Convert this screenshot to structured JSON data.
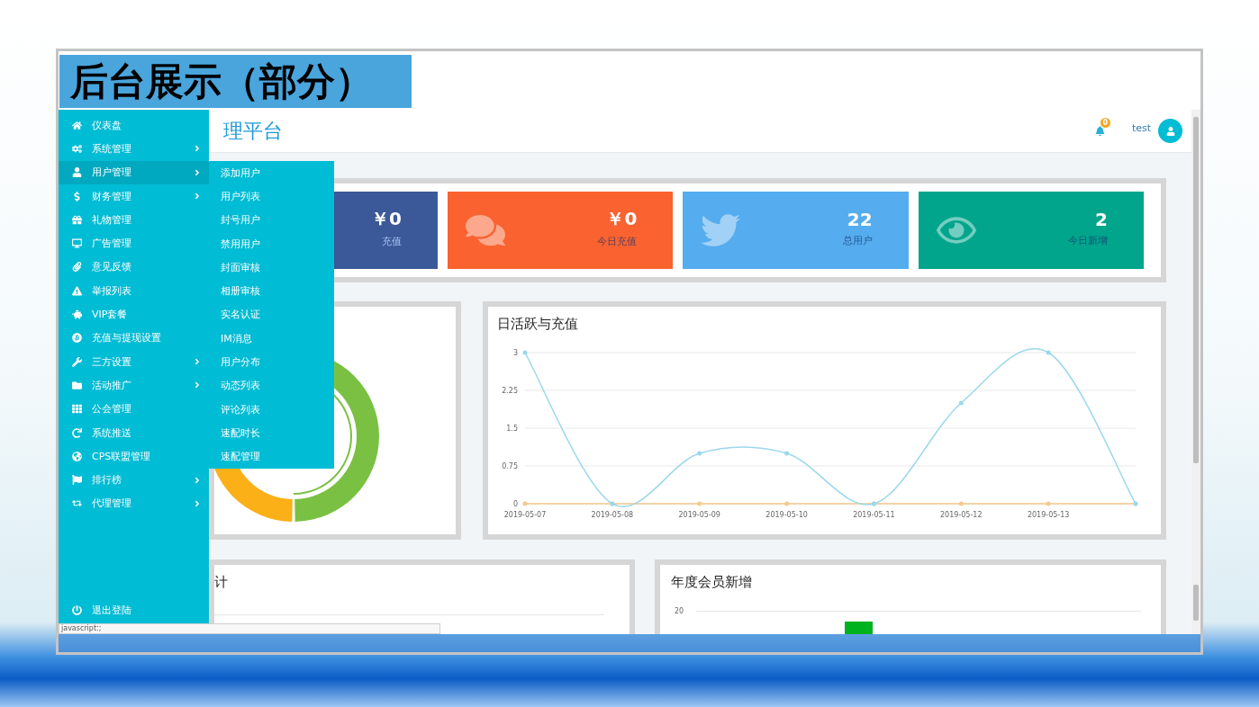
{
  "slide_title": "后台展示（部分）",
  "app": {
    "header": {
      "title": "理平台",
      "notifications": "0",
      "user": "test"
    },
    "sidebar": {
      "items": [
        {
          "label": "仪表盘",
          "selected": false,
          "submenu": false
        },
        {
          "label": "系统管理",
          "selected": false,
          "submenu": true
        },
        {
          "label": "用户管理",
          "selected": true,
          "submenu": true
        },
        {
          "label": "财务管理",
          "selected": false,
          "submenu": true
        },
        {
          "label": "礼物管理",
          "selected": false,
          "submenu": false
        },
        {
          "label": "广告管理",
          "selected": false,
          "submenu": false
        },
        {
          "label": "意见反馈",
          "selected": false,
          "submenu": false
        },
        {
          "label": "举报列表",
          "selected": false,
          "submenu": false
        },
        {
          "label": "VIP套餐",
          "selected": false,
          "submenu": false
        },
        {
          "label": "充值与提现设置",
          "selected": false,
          "submenu": false
        },
        {
          "label": "三方设置",
          "selected": false,
          "submenu": true
        },
        {
          "label": "活动推广",
          "selected": false,
          "submenu": true
        },
        {
          "label": "公会管理",
          "selected": false,
          "submenu": false
        },
        {
          "label": "系统推送",
          "selected": false,
          "submenu": false
        },
        {
          "label": "CPS联盟管理",
          "selected": false,
          "submenu": false
        },
        {
          "label": "排行榜",
          "selected": false,
          "submenu": true
        },
        {
          "label": "代理管理",
          "selected": false,
          "submenu": true
        }
      ],
      "logout": "退出登陆"
    },
    "submenu": {
      "items": [
        "添加用户",
        "用户列表",
        "封号用户",
        "禁用用户",
        "封面审核",
        "相册审核",
        "实名认证",
        "IM消息",
        "用户分布",
        "动态列表",
        "评论列表",
        "速配时长",
        "速配管理"
      ]
    },
    "stat_cards": [
      {
        "value": "￥0",
        "label": "充值",
        "color": "#3b5998"
      },
      {
        "value": "￥0",
        "label": "今日充值",
        "color": "#fa6230"
      },
      {
        "value": "22",
        "label": "总用户",
        "color": "#55acee"
      },
      {
        "value": "2",
        "label": "今日新增",
        "color": "#00a58c"
      }
    ],
    "line_chart_panel": {
      "title": "日活跃与充值",
      "chart_data": {
        "type": "line",
        "categories": [
          "2019-05-07",
          "2019-05-08",
          "2019-05-09",
          "2019-05-10",
          "2019-05-11",
          "2019-05-12",
          "2019-05-13",
          null
        ],
        "ylim": [
          0,
          3
        ],
        "grid": true,
        "yticks": [
          {
            "value": 0,
            "label": "0"
          },
          {
            "value": 0.75,
            "label": "0.75"
          },
          {
            "value": 1.5,
            "label": "1.5"
          },
          {
            "value": 2.25,
            "label": "2.25"
          },
          {
            "value": 3,
            "label": "3"
          }
        ],
        "series": [
          {
            "color": "#9ad8ec",
            "values": [
              3,
              0,
              1,
              1,
              0,
              2,
              3,
              0
            ]
          },
          {
            "color": "#f5c98e",
            "values": [
              0,
              0,
              0,
              0,
              0,
              0,
              0,
              0
            ]
          }
        ]
      }
    },
    "bottom_left_panel": {
      "title": "计"
    },
    "bottom_right_panel": {
      "title": "年度会员新增",
      "tick_label": "20"
    },
    "status_bar": "javascript:;"
  }
}
